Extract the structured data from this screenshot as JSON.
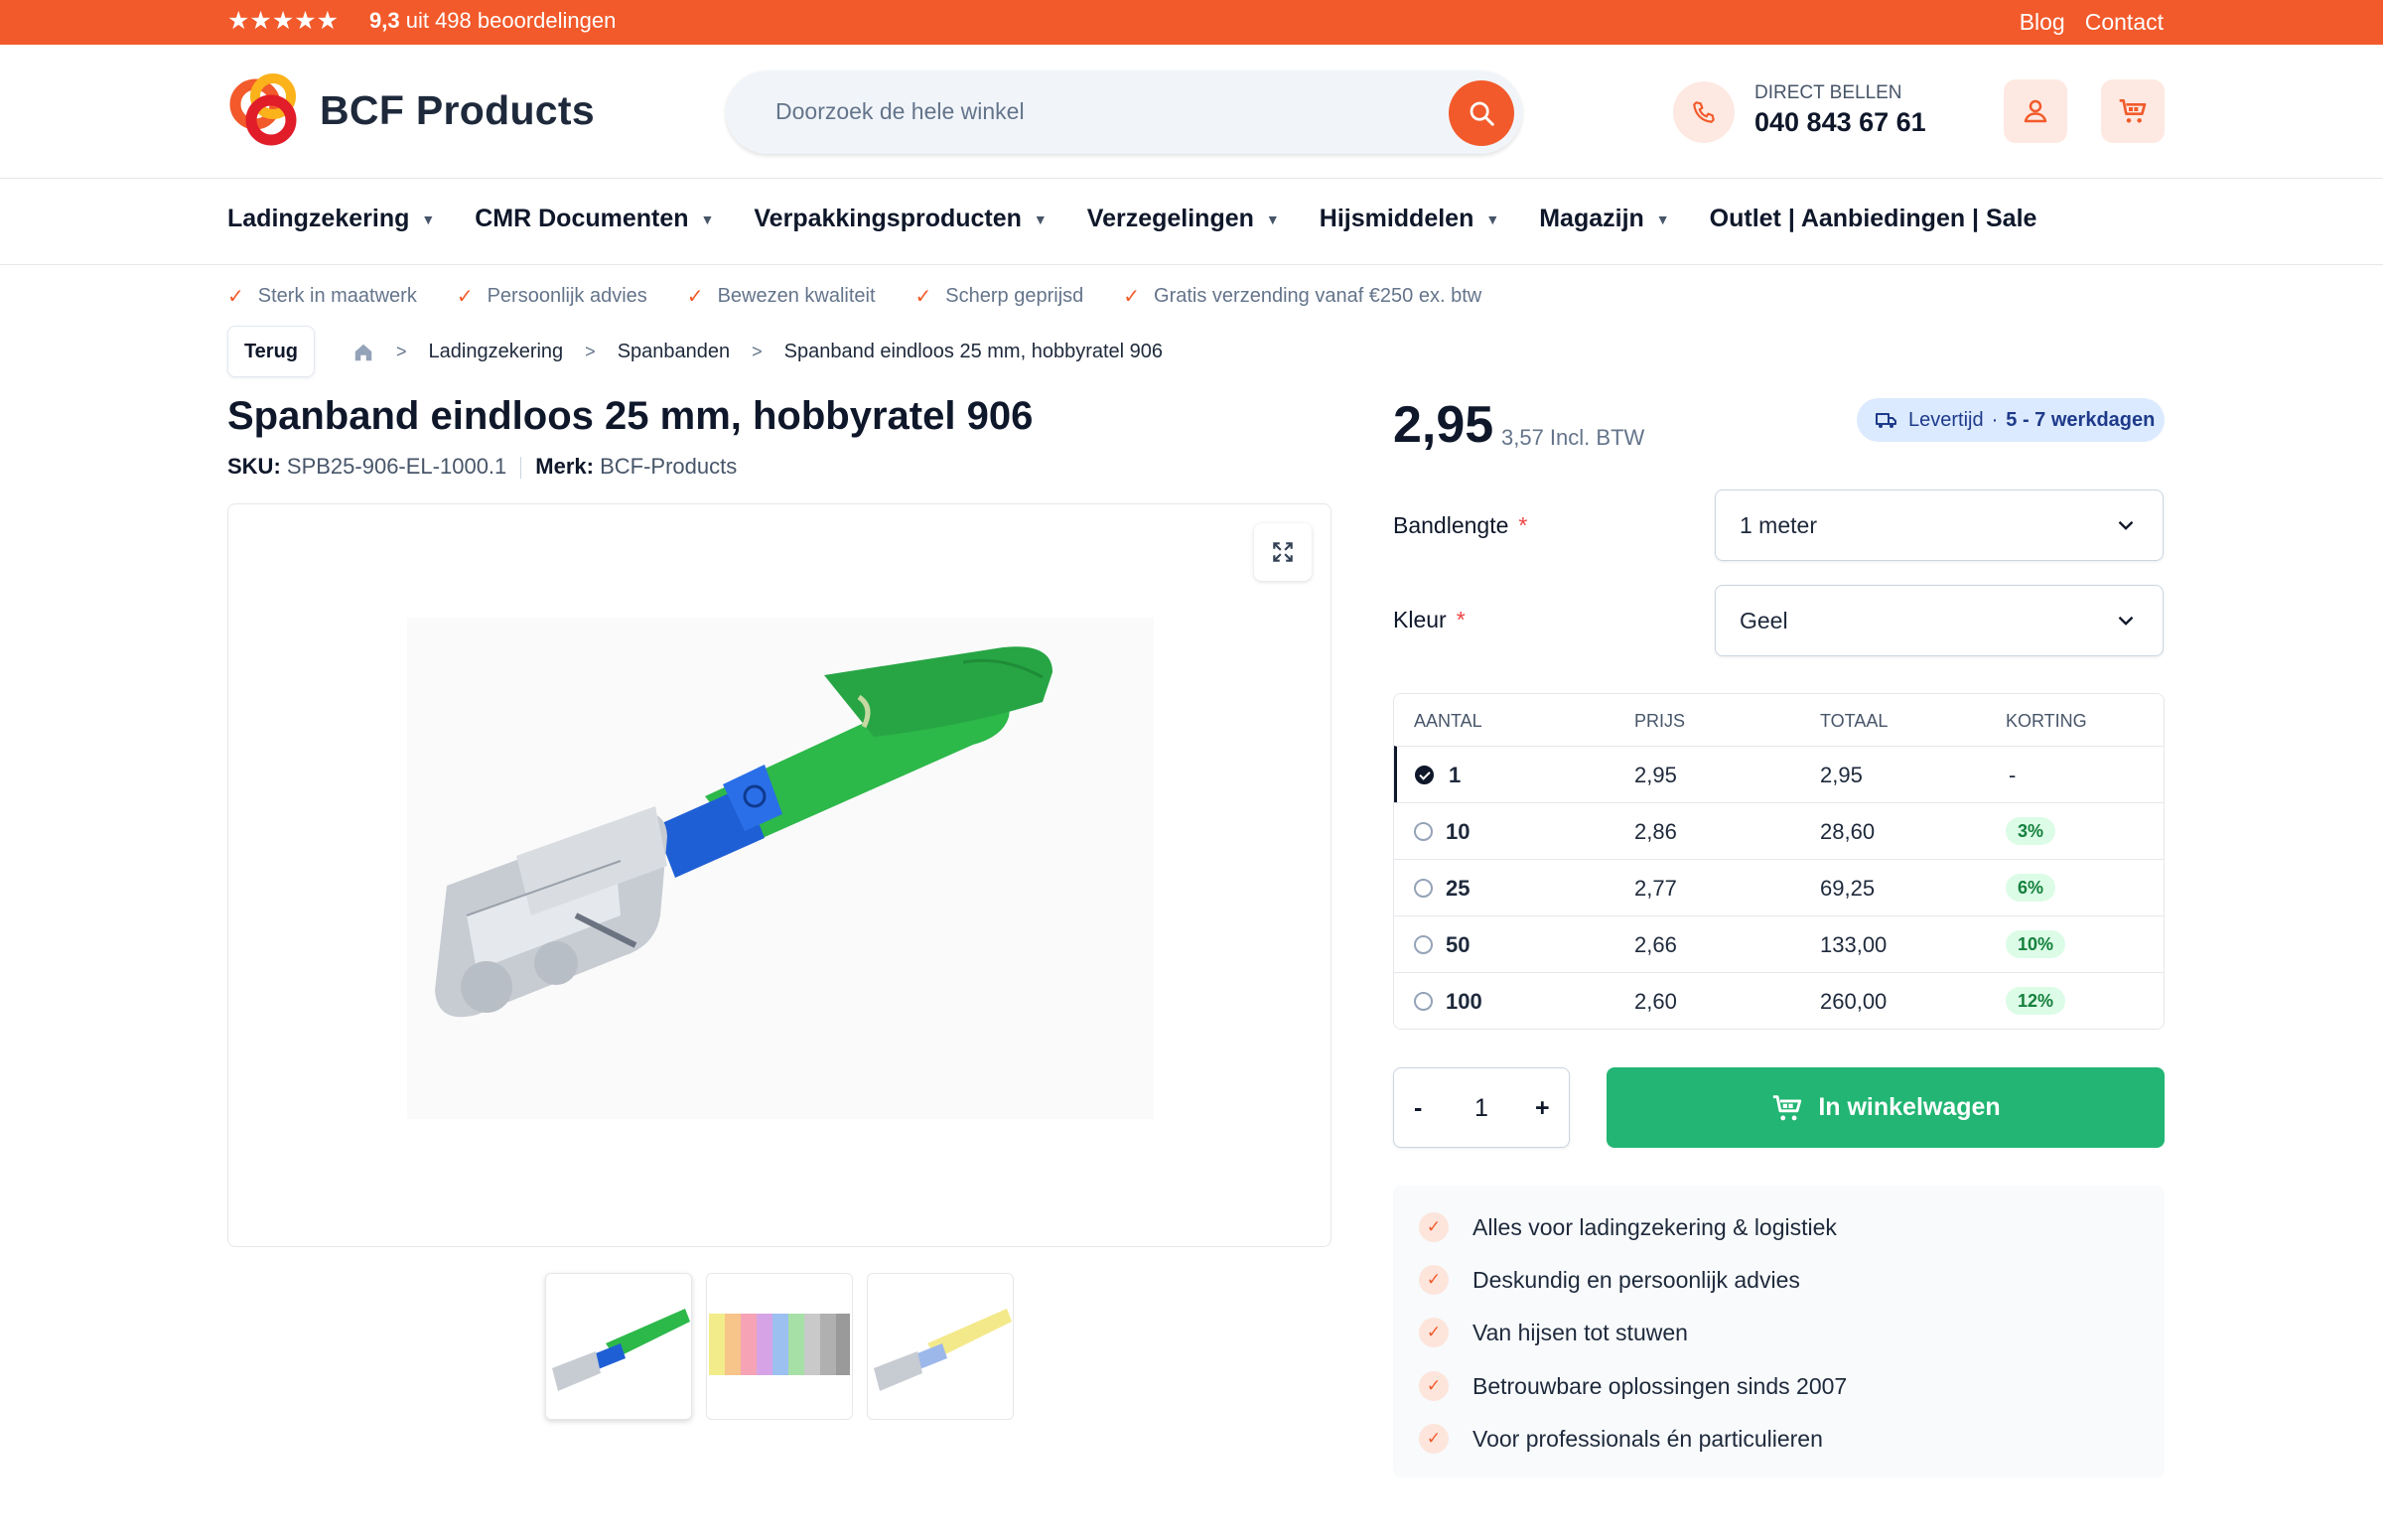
{
  "topbar": {
    "stars": "★★★★★",
    "rating_score": "9,3",
    "rating_text": "uit 498 beoordelingen",
    "links": [
      "Blog",
      "Contact"
    ]
  },
  "header": {
    "logo_text": "BCF Products",
    "search_placeholder": "Doorzoek de hele winkel",
    "call_label": "DIRECT BELLEN",
    "call_number": "040 843 67 61"
  },
  "nav": [
    "Ladingzekering",
    "CMR Documenten",
    "Verpakkingsproducten",
    "Verzegelingen",
    "Hijsmiddelen",
    "Magazijn",
    "Outlet | Aanbiedingen | Sale"
  ],
  "nav_chevrons": [
    true,
    true,
    true,
    true,
    true,
    true,
    false
  ],
  "usps": [
    "Sterk in maatwerk",
    "Persoonlijk advies",
    "Bewezen kwaliteit",
    "Scherp geprijsd",
    "Gratis verzending vanaf €250 ex. btw"
  ],
  "breadcrumb": {
    "back": "Terug",
    "items": [
      "Ladingzekering",
      "Spanbanden",
      "Spanband eindloos 25 mm, hobbyratel 906"
    ]
  },
  "product": {
    "title": "Spanband eindloos 25 mm, hobbyratel 906",
    "sku_label": "SKU:",
    "sku": "SPB25-906-EL-1000.1",
    "brand_label": "Merk:",
    "brand": "BCF-Products",
    "price": "2,95",
    "price_incl": "3,57 Incl. BTW",
    "delivery_label": "Levertijd",
    "delivery_value": "5 - 7 werkdagen"
  },
  "options": {
    "length_label": "Bandlengte",
    "length_value": "1 meter",
    "color_label": "Kleur",
    "color_value": "Geel",
    "required_mark": "*"
  },
  "tiers": {
    "headers": [
      "AANTAL",
      "PRIJS",
      "TOTAAL",
      "KORTING"
    ],
    "rows": [
      {
        "qty": "1",
        "price": "2,95",
        "total": "2,95",
        "discount": "-",
        "selected": true
      },
      {
        "qty": "10",
        "price": "2,86",
        "total": "28,60",
        "discount": "3%",
        "selected": false
      },
      {
        "qty": "25",
        "price": "2,77",
        "total": "69,25",
        "discount": "6%",
        "selected": false
      },
      {
        "qty": "50",
        "price": "2,66",
        "total": "133,00",
        "discount": "10%",
        "selected": false
      },
      {
        "qty": "100",
        "price": "2,60",
        "total": "260,00",
        "discount": "12%",
        "selected": false
      }
    ]
  },
  "cart": {
    "minus": "-",
    "qty": "1",
    "plus": "+",
    "button": "In winkelwagen"
  },
  "benefits": [
    "Alles voor ladingzekering & logistiek",
    "Deskundig en persoonlijk advies",
    "Van hijsen tot stuwen",
    "Betrouwbare oplossingen sinds 2007",
    "Voor professionals én particulieren"
  ],
  "colors": {
    "brand": "#f25a2b",
    "cta": "#22b573",
    "strap_green": "#2db84a",
    "strap_blue": "#1f5fd6"
  }
}
